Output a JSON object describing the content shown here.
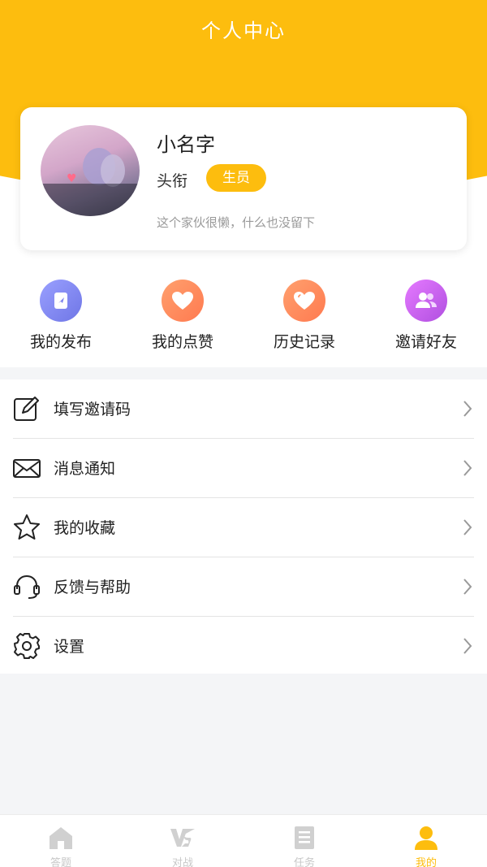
{
  "header": {
    "title": "个人中心"
  },
  "profile": {
    "name": "小名字",
    "title_label": "头衔",
    "badge": "生员",
    "bio": "这个家伙很懒，什么也没留下"
  },
  "quick_actions": [
    {
      "label": "我的发布",
      "icon": "publish-icon",
      "color": "#8a8fef"
    },
    {
      "label": "我的点赞",
      "icon": "heart-icon",
      "color": "#ff8a5b"
    },
    {
      "label": "历史记录",
      "icon": "history-heart-icon",
      "color": "#ff8a5b"
    },
    {
      "label": "邀请好友",
      "icon": "friends-icon",
      "color": "#c25fe0"
    }
  ],
  "menu": [
    {
      "label": "填写邀请码",
      "icon": "edit-icon"
    },
    {
      "label": "消息通知",
      "icon": "mail-icon"
    },
    {
      "label": "我的收藏",
      "icon": "star-icon"
    },
    {
      "label": "反馈与帮助",
      "icon": "headset-icon"
    },
    {
      "label": "设置",
      "icon": "gear-icon"
    }
  ],
  "tabbar": [
    {
      "label": "答题",
      "icon": "home-icon",
      "active": false
    },
    {
      "label": "对战",
      "icon": "vs-icon",
      "active": false
    },
    {
      "label": "任务",
      "icon": "task-icon",
      "active": false
    },
    {
      "label": "我的",
      "icon": "user-icon",
      "active": true
    }
  ],
  "colors": {
    "accent": "#fdbd0e",
    "inactive": "#c8c8c8"
  }
}
